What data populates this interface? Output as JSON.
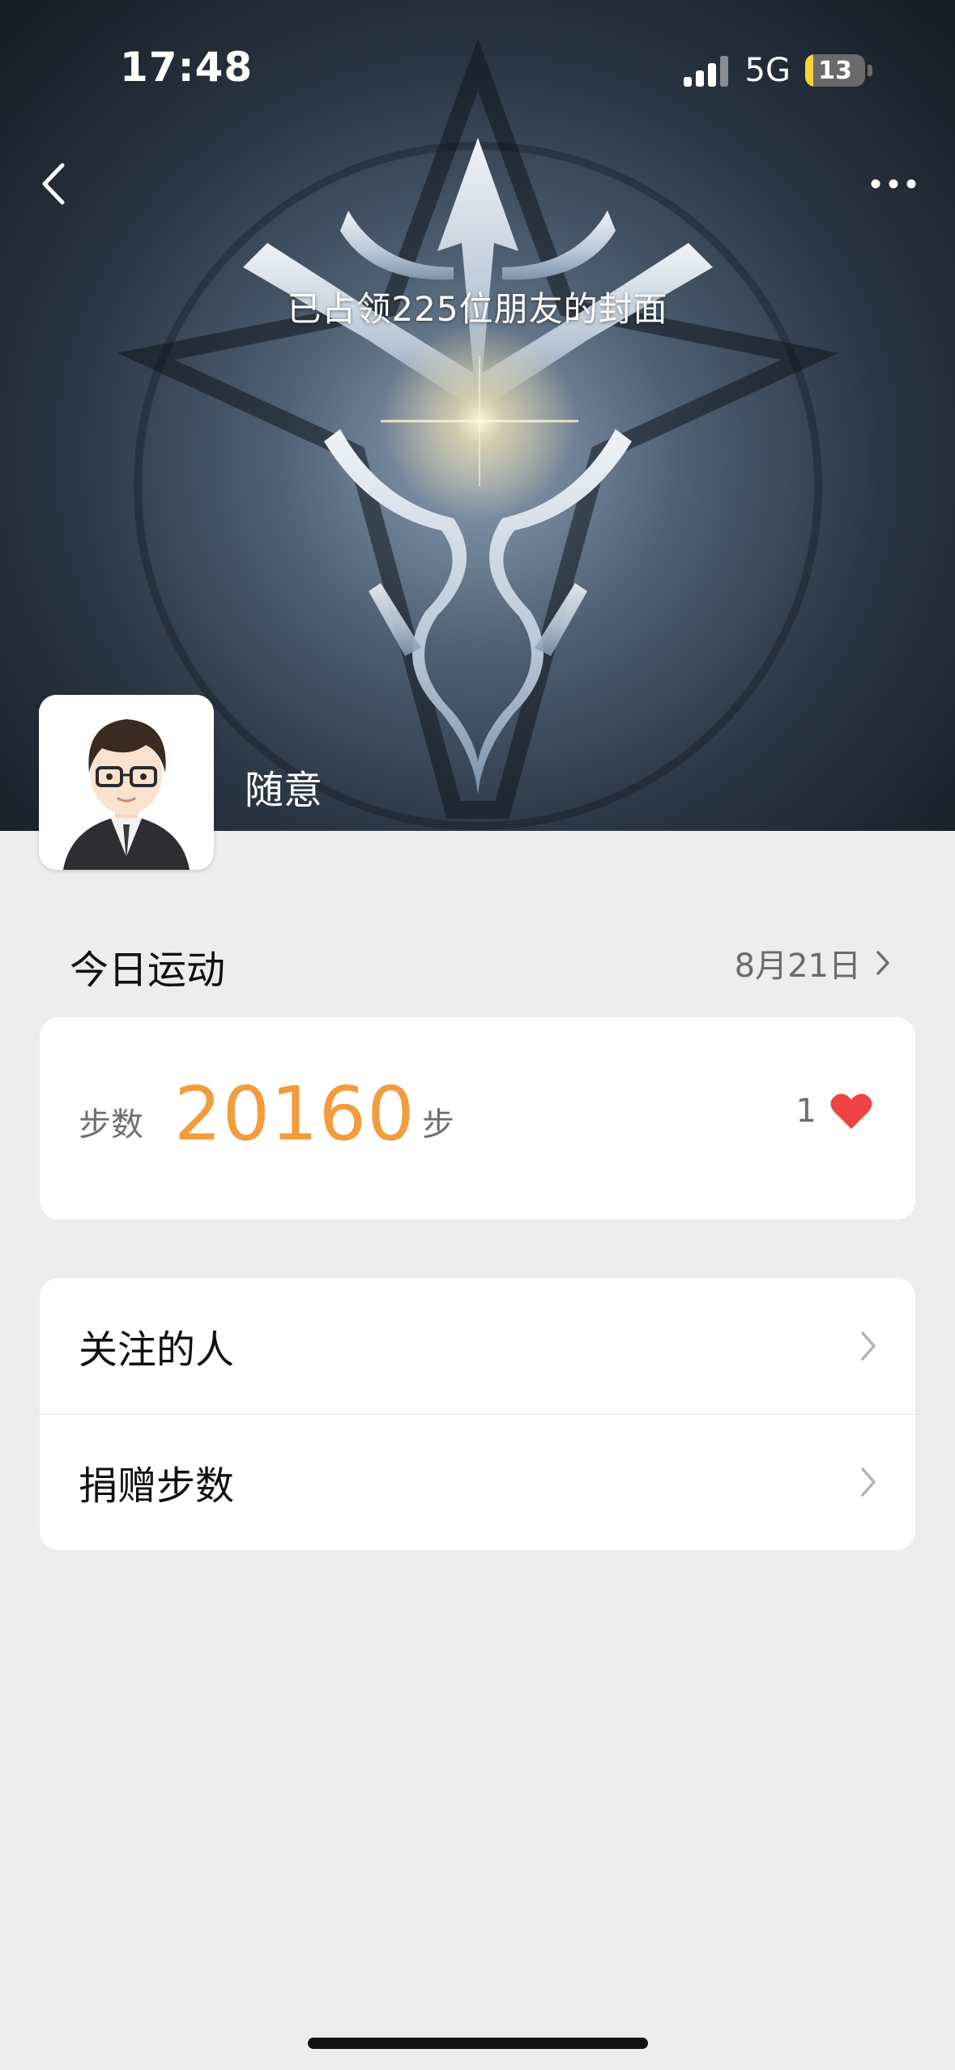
{
  "status_bar": {
    "time": "17:48",
    "network": "5G",
    "battery_level": "13"
  },
  "cover": {
    "caption": "已占领225位朋友的封面"
  },
  "profile": {
    "name": "随意"
  },
  "today": {
    "title": "今日运动",
    "date": "8月21日"
  },
  "steps": {
    "label": "步数",
    "value": "20160",
    "unit": "步",
    "likes": "1"
  },
  "menu": {
    "items": [
      {
        "label": "关注的人"
      },
      {
        "label": "捐赠步数"
      }
    ]
  },
  "colors": {
    "accent": "#f39c3d",
    "heart": "#f04343",
    "background": "#ededed"
  }
}
